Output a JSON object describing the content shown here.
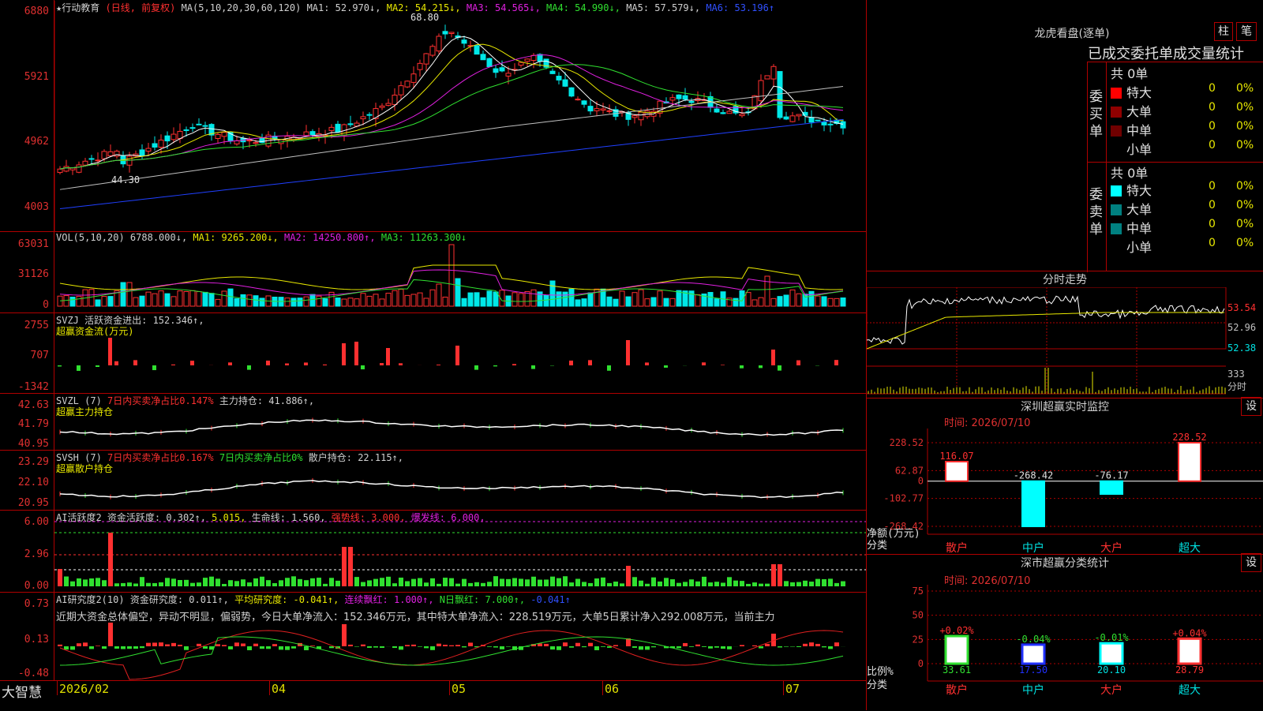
{
  "main": {
    "stock_name": "★行动教育",
    "period": "(日线, 前复权)",
    "ma_header": [
      {
        "text": "MA(5,10,20,30,60,120)",
        "cls": "w"
      },
      {
        "text": "MA1: 52.970↓,",
        "cls": "w"
      },
      {
        "text": "MA2: 54.215↓,",
        "cls": "y"
      },
      {
        "text": "MA3: 54.565↓,",
        "cls": "m"
      },
      {
        "text": "MA4: 54.990↓,",
        "cls": "g"
      },
      {
        "text": "MA5: 57.579↓,",
        "cls": "w"
      },
      {
        "text": "MA6: 53.196↑",
        "cls": "b"
      }
    ],
    "y_labels": [
      "6880",
      "5921",
      "4962",
      "4003"
    ],
    "high_label": "68.80",
    "low_label": "44.30"
  },
  "vol": {
    "header": [
      {
        "text": "VOL(5,10,20)",
        "cls": "w"
      },
      {
        "text": "6788.000↓,",
        "cls": "w"
      },
      {
        "text": "MA1: 9265.200↓,",
        "cls": "y"
      },
      {
        "text": "MA2: 14250.800↑,",
        "cls": "m"
      },
      {
        "text": "MA3: 11263.300↓",
        "cls": "g"
      }
    ],
    "y_labels": [
      "63031",
      "31126",
      "0"
    ]
  },
  "svzj": {
    "header": [
      {
        "text": "SVZJ",
        "cls": "w"
      },
      {
        "text": "活跃资金进出: 152.346↑,",
        "cls": "w"
      }
    ],
    "sub": "超赢资金流(万元)",
    "y_labels": [
      "2755",
      "707",
      "-1342"
    ]
  },
  "svzl": {
    "header": [
      {
        "text": "SVZL (7)",
        "cls": "w"
      },
      {
        "text": "7日内买卖净占比0.147%",
        "cls": "r"
      },
      {
        "text": "主力持仓: 41.886↑,",
        "cls": "w"
      }
    ],
    "sub": "超赢主力持仓",
    "y_labels": [
      "42.63",
      "41.79",
      "40.95"
    ]
  },
  "svsh": {
    "header": [
      {
        "text": "SVSH (7)",
        "cls": "w"
      },
      {
        "text": "7日内买卖净占比0.167%",
        "cls": "r"
      },
      {
        "text": "7日内买卖净占比0%",
        "cls": "g"
      },
      {
        "text": "散户持仓: 22.115↑,",
        "cls": "w"
      }
    ],
    "sub": "超赢散户持仓",
    "y_labels": [
      "23.29",
      "22.10",
      "20.95"
    ]
  },
  "ai_active": {
    "header": [
      {
        "text": "AI活跃度2",
        "cls": "w"
      },
      {
        "text": "资金活跃度: 0.302↑,",
        "cls": "w"
      },
      {
        "text": "5.015,",
        "cls": "y"
      },
      {
        "text": "生命线: 1.560,",
        "cls": "w"
      },
      {
        "text": "强势线: 3.000,",
        "cls": "r"
      },
      {
        "text": "爆发线: 6.000,",
        "cls": "m"
      }
    ],
    "y_labels": [
      "6.00",
      "2.96",
      "0.00"
    ]
  },
  "ai_research": {
    "header": [
      {
        "text": "AI研究度2(10)",
        "cls": "w"
      },
      {
        "text": "资金研究度: 0.011↑,",
        "cls": "w"
      },
      {
        "text": "平均研究度: -0.041↑,",
        "cls": "y"
      },
      {
        "text": "连续飘红: 1.000↑,",
        "cls": "m"
      },
      {
        "text": "N日飘红: 7.000↑,",
        "cls": "g"
      },
      {
        "text": "-0.041↑",
        "cls": "b"
      }
    ],
    "commentary": "近期大资金总体偏空，异动不明显，偏弱势，今日大单净流入：152.346万元，其中特大单净流入：228.519万元，大单5日累计净入292.008万元，当前主力",
    "y_labels": [
      "0.73",
      "0.13",
      "-0.48"
    ]
  },
  "bottom_bar": {
    "brand": "大智慧",
    "dates": [
      "2026/02",
      "04",
      "05",
      "06",
      "07"
    ]
  },
  "right": {
    "longhu_title": "龙虎看盘(逐单)",
    "btn_bar": "柱",
    "btn_stroke": "笔",
    "stat_title": "已成交委托单成交量统计",
    "buy_label": "委买单",
    "sell_label": "委卖单",
    "buy_total": "共 0单",
    "sell_total": "共 0单",
    "buy_rows": [
      {
        "label": "特大",
        "value": "0",
        "pct": "0%",
        "color": "#ff0000"
      },
      {
        "label": "大单",
        "value": "0",
        "pct": "0%",
        "color": "#900000"
      },
      {
        "label": "中单",
        "value": "0",
        "pct": "0%",
        "color": "#700000"
      },
      {
        "label": "小单",
        "value": "0",
        "pct": "0%",
        "color": "#000000"
      }
    ],
    "sell_rows": [
      {
        "label": "特大",
        "value": "0",
        "pct": "0%",
        "color": "#00ffff"
      },
      {
        "label": "大单",
        "value": "0",
        "pct": "0%",
        "color": "#008080"
      },
      {
        "label": "中单",
        "value": "0",
        "pct": "0%",
        "color": "#008080"
      },
      {
        "label": "小单",
        "value": "0",
        "pct": "0%",
        "color": "#000000"
      }
    ],
    "intraday_title": "分时走势",
    "intraday_labels": [
      "53.54",
      "52.96",
      "52.38",
      "333",
      "分时"
    ],
    "sz_monitor_title": "深圳超赢实时监控",
    "sz_monitor_time": "时间: 2026/07/10",
    "set_btn": "设",
    "monitor_y": [
      "228.52",
      "62.87",
      "0",
      "-102.77",
      "-268.42"
    ],
    "monitor_ylabel": "净额(万元)",
    "monitor_xlabel": "分类",
    "monitor_bars": [
      {
        "cat": "散户",
        "value": 116.07,
        "label": "116.07"
      },
      {
        "cat": "中户",
        "value": -268.42,
        "label": "-268.42"
      },
      {
        "cat": "大户",
        "value": -76.17,
        "label": "-76.17"
      },
      {
        "cat": "超大",
        "value": 228.52,
        "label": "228.52"
      }
    ],
    "sz_class_title": "深市超赢分类统计",
    "sz_class_time": "时间: 2026/07/10",
    "class_y": [
      "75",
      "50",
      "25",
      "0"
    ],
    "class_ylabel": "比例%",
    "class_xlabel": "分类",
    "class_bars": [
      {
        "cat": "散户",
        "value": 33.61,
        "label": "33.61",
        "delta": "+0.02%"
      },
      {
        "cat": "中户",
        "value": 17.5,
        "label": "17.50",
        "delta": "-0.04%"
      },
      {
        "cat": "大户",
        "value": 20.1,
        "label": "20.10",
        "delta": "-0.01%"
      },
      {
        "cat": "超大",
        "value": 28.79,
        "label": "28.79",
        "delta": "+0.04%"
      }
    ]
  },
  "colors": {
    "up": "#ff3030",
    "down": "#00e8e8",
    "grid": "#b00000",
    "axis": "#e03030"
  }
}
